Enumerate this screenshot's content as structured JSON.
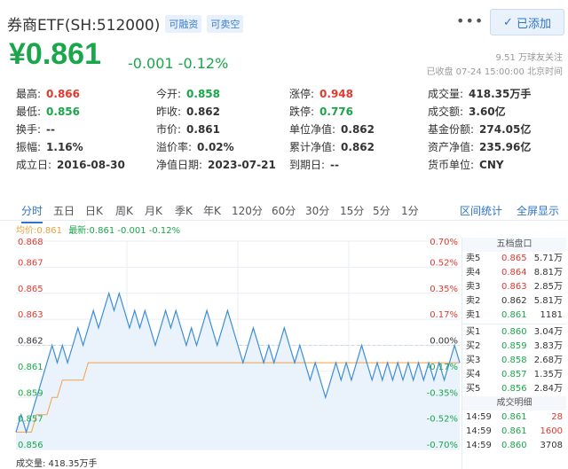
{
  "header": {
    "name": "券商ETF(SH:512000)",
    "tags": [
      "可融资",
      "可卖空"
    ],
    "more": "•••",
    "follow_check": "✓",
    "follow_label": "已添加",
    "price": "¥0.861",
    "change": "-0.001 -0.12%",
    "followers": "9.51 万球友关注",
    "status": "已收盘 07-24 15:00:00 北京时间"
  },
  "stats": [
    [
      {
        "label": "最高:",
        "value": "0.866",
        "color": "red"
      },
      {
        "label": "今开:",
        "value": "0.858",
        "color": "green"
      },
      {
        "label": "涨停:",
        "value": "0.948",
        "color": "red"
      },
      {
        "label": "成交量:",
        "value": "418.35万手",
        "color": ""
      }
    ],
    [
      {
        "label": "最低:",
        "value": "0.856",
        "color": "green"
      },
      {
        "label": "昨收:",
        "value": "0.862",
        "color": ""
      },
      {
        "label": "跌停:",
        "value": "0.776",
        "color": "green"
      },
      {
        "label": "成交额:",
        "value": "3.60亿",
        "color": ""
      }
    ],
    [
      {
        "label": "换手:",
        "value": "--",
        "color": ""
      },
      {
        "label": "市价:",
        "value": "0.861",
        "color": ""
      },
      {
        "label": "单位净值:",
        "value": "0.862",
        "color": ""
      },
      {
        "label": "基金份额:",
        "value": "274.05亿",
        "color": ""
      }
    ],
    [
      {
        "label": "振幅:",
        "value": "1.16%",
        "color": ""
      },
      {
        "label": "溢价率:",
        "value": "0.02%",
        "color": ""
      },
      {
        "label": "累计净值:",
        "value": "0.862",
        "color": ""
      },
      {
        "label": "资产净值:",
        "value": "235.96亿",
        "color": ""
      }
    ],
    [
      {
        "label": "成立日:",
        "value": "2016-08-30",
        "color": ""
      },
      {
        "label": "净值日期:",
        "value": "2023-07-21",
        "color": ""
      },
      {
        "label": "到期日:",
        "value": "--",
        "color": ""
      },
      {
        "label": "货币单位:",
        "value": "CNY",
        "color": ""
      }
    ]
  ],
  "tabs": [
    "分时",
    "五日",
    "日K",
    "周K",
    "月K",
    "季K",
    "年K",
    "120分",
    "60分",
    "30分",
    "15分",
    "5分",
    "1分"
  ],
  "tab_right": [
    "区间统计",
    "全屏显示"
  ],
  "legend": {
    "avg": "均价:0.861",
    "latest": "最新:0.861 -0.001 -0.12%"
  },
  "chart_data": {
    "type": "line",
    "y_left_ticks": [
      "0.868",
      "0.867",
      "0.865",
      "0.863",
      "0.862",
      "0.861",
      "0.859",
      "0.857",
      "0.856"
    ],
    "y_right_ticks": [
      "0.70%",
      "0.52%",
      "0.35%",
      "0.17%",
      "0.00%",
      "-0.17%",
      "-0.35%",
      "-0.52%",
      "-0.70%"
    ],
    "ylim": [
      0.856,
      0.868
    ],
    "prev_close": 0.862,
    "series": [
      {
        "values": [
          0.857,
          0.858,
          0.857,
          0.858,
          0.859,
          0.86,
          0.861,
          0.862,
          0.861,
          0.862,
          0.861,
          0.862,
          0.863,
          0.862,
          0.863,
          0.864,
          0.863,
          0.864,
          0.865,
          0.864,
          0.865,
          0.864,
          0.863,
          0.864,
          0.863,
          0.864,
          0.863,
          0.862,
          0.863,
          0.864,
          0.863,
          0.864,
          0.863,
          0.862,
          0.863,
          0.862,
          0.863,
          0.864,
          0.863,
          0.862,
          0.863,
          0.864,
          0.863,
          0.862,
          0.861,
          0.862,
          0.863,
          0.862,
          0.861,
          0.862,
          0.861,
          0.862,
          0.863,
          0.862,
          0.861,
          0.862,
          0.861,
          0.86,
          0.861,
          0.86,
          0.859,
          0.86,
          0.861,
          0.86,
          0.861,
          0.86,
          0.861,
          0.862,
          0.861,
          0.86,
          0.861,
          0.86,
          0.861,
          0.86,
          0.861,
          0.86,
          0.861,
          0.86,
          0.861,
          0.86,
          0.861,
          0.86,
          0.861,
          0.86,
          0.861,
          0.862,
          0.861
        ]
      },
      {
        "values": [
          0.857,
          0.857,
          0.857,
          0.857,
          0.858,
          0.858,
          0.858,
          0.859,
          0.859,
          0.86,
          0.86,
          0.86,
          0.86,
          0.86,
          0.861,
          0.861,
          0.861,
          0.861,
          0.861,
          0.861,
          0.861,
          0.861,
          0.861,
          0.861,
          0.861,
          0.861,
          0.861,
          0.861,
          0.861,
          0.861,
          0.861,
          0.861,
          0.861,
          0.861,
          0.861,
          0.861,
          0.861,
          0.861,
          0.861,
          0.861,
          0.861,
          0.861,
          0.861,
          0.861,
          0.861,
          0.861,
          0.861,
          0.861,
          0.861,
          0.861,
          0.861,
          0.861,
          0.861,
          0.861,
          0.861,
          0.861,
          0.861,
          0.861,
          0.861,
          0.861,
          0.861,
          0.861,
          0.861,
          0.861,
          0.861,
          0.861,
          0.861,
          0.861,
          0.861,
          0.861,
          0.861,
          0.861,
          0.861,
          0.861,
          0.861,
          0.861,
          0.861,
          0.861,
          0.861,
          0.861,
          0.861,
          0.861,
          0.861,
          0.861,
          0.861,
          0.861,
          0.861
        ]
      }
    ],
    "colors": {
      "price": "#3d8ed8",
      "avg": "#f0a24a",
      "fill": "#eaf3fc",
      "grid": "#e8eef5"
    }
  },
  "volume": "成交量: 418.35万手",
  "order_book": {
    "title": "五档盘口",
    "rows": [
      {
        "label": "卖5",
        "price": "0.865",
        "qty": "5.71万",
        "color": "red"
      },
      {
        "label": "卖4",
        "price": "0.864",
        "qty": "8.81万",
        "color": "red"
      },
      {
        "label": "卖3",
        "price": "0.863",
        "qty": "2.85万",
        "color": "red"
      },
      {
        "label": "卖2",
        "price": "0.862",
        "qty": "5.81万",
        "color": ""
      },
      {
        "label": "卖1",
        "price": "0.861",
        "qty": "1181",
        "color": "green"
      },
      {
        "label": "买1",
        "price": "0.860",
        "qty": "3.04万",
        "color": "green"
      },
      {
        "label": "买2",
        "price": "0.859",
        "qty": "3.83万",
        "color": "green"
      },
      {
        "label": "买3",
        "price": "0.858",
        "qty": "2.68万",
        "color": "green"
      },
      {
        "label": "买4",
        "price": "0.857",
        "qty": "1.35万",
        "color": "green"
      },
      {
        "label": "买5",
        "price": "0.856",
        "qty": "2.84万",
        "color": "green"
      }
    ]
  },
  "trades": {
    "title": "成交明细",
    "rows": [
      {
        "time": "14:59",
        "price": "0.861",
        "qty": "28",
        "qcolor": "red"
      },
      {
        "time": "14:59",
        "price": "0.861",
        "qty": "1600",
        "qcolor": "red"
      },
      {
        "time": "14:59",
        "price": "0.860",
        "qty": "3708",
        "qcolor": ""
      }
    ]
  }
}
